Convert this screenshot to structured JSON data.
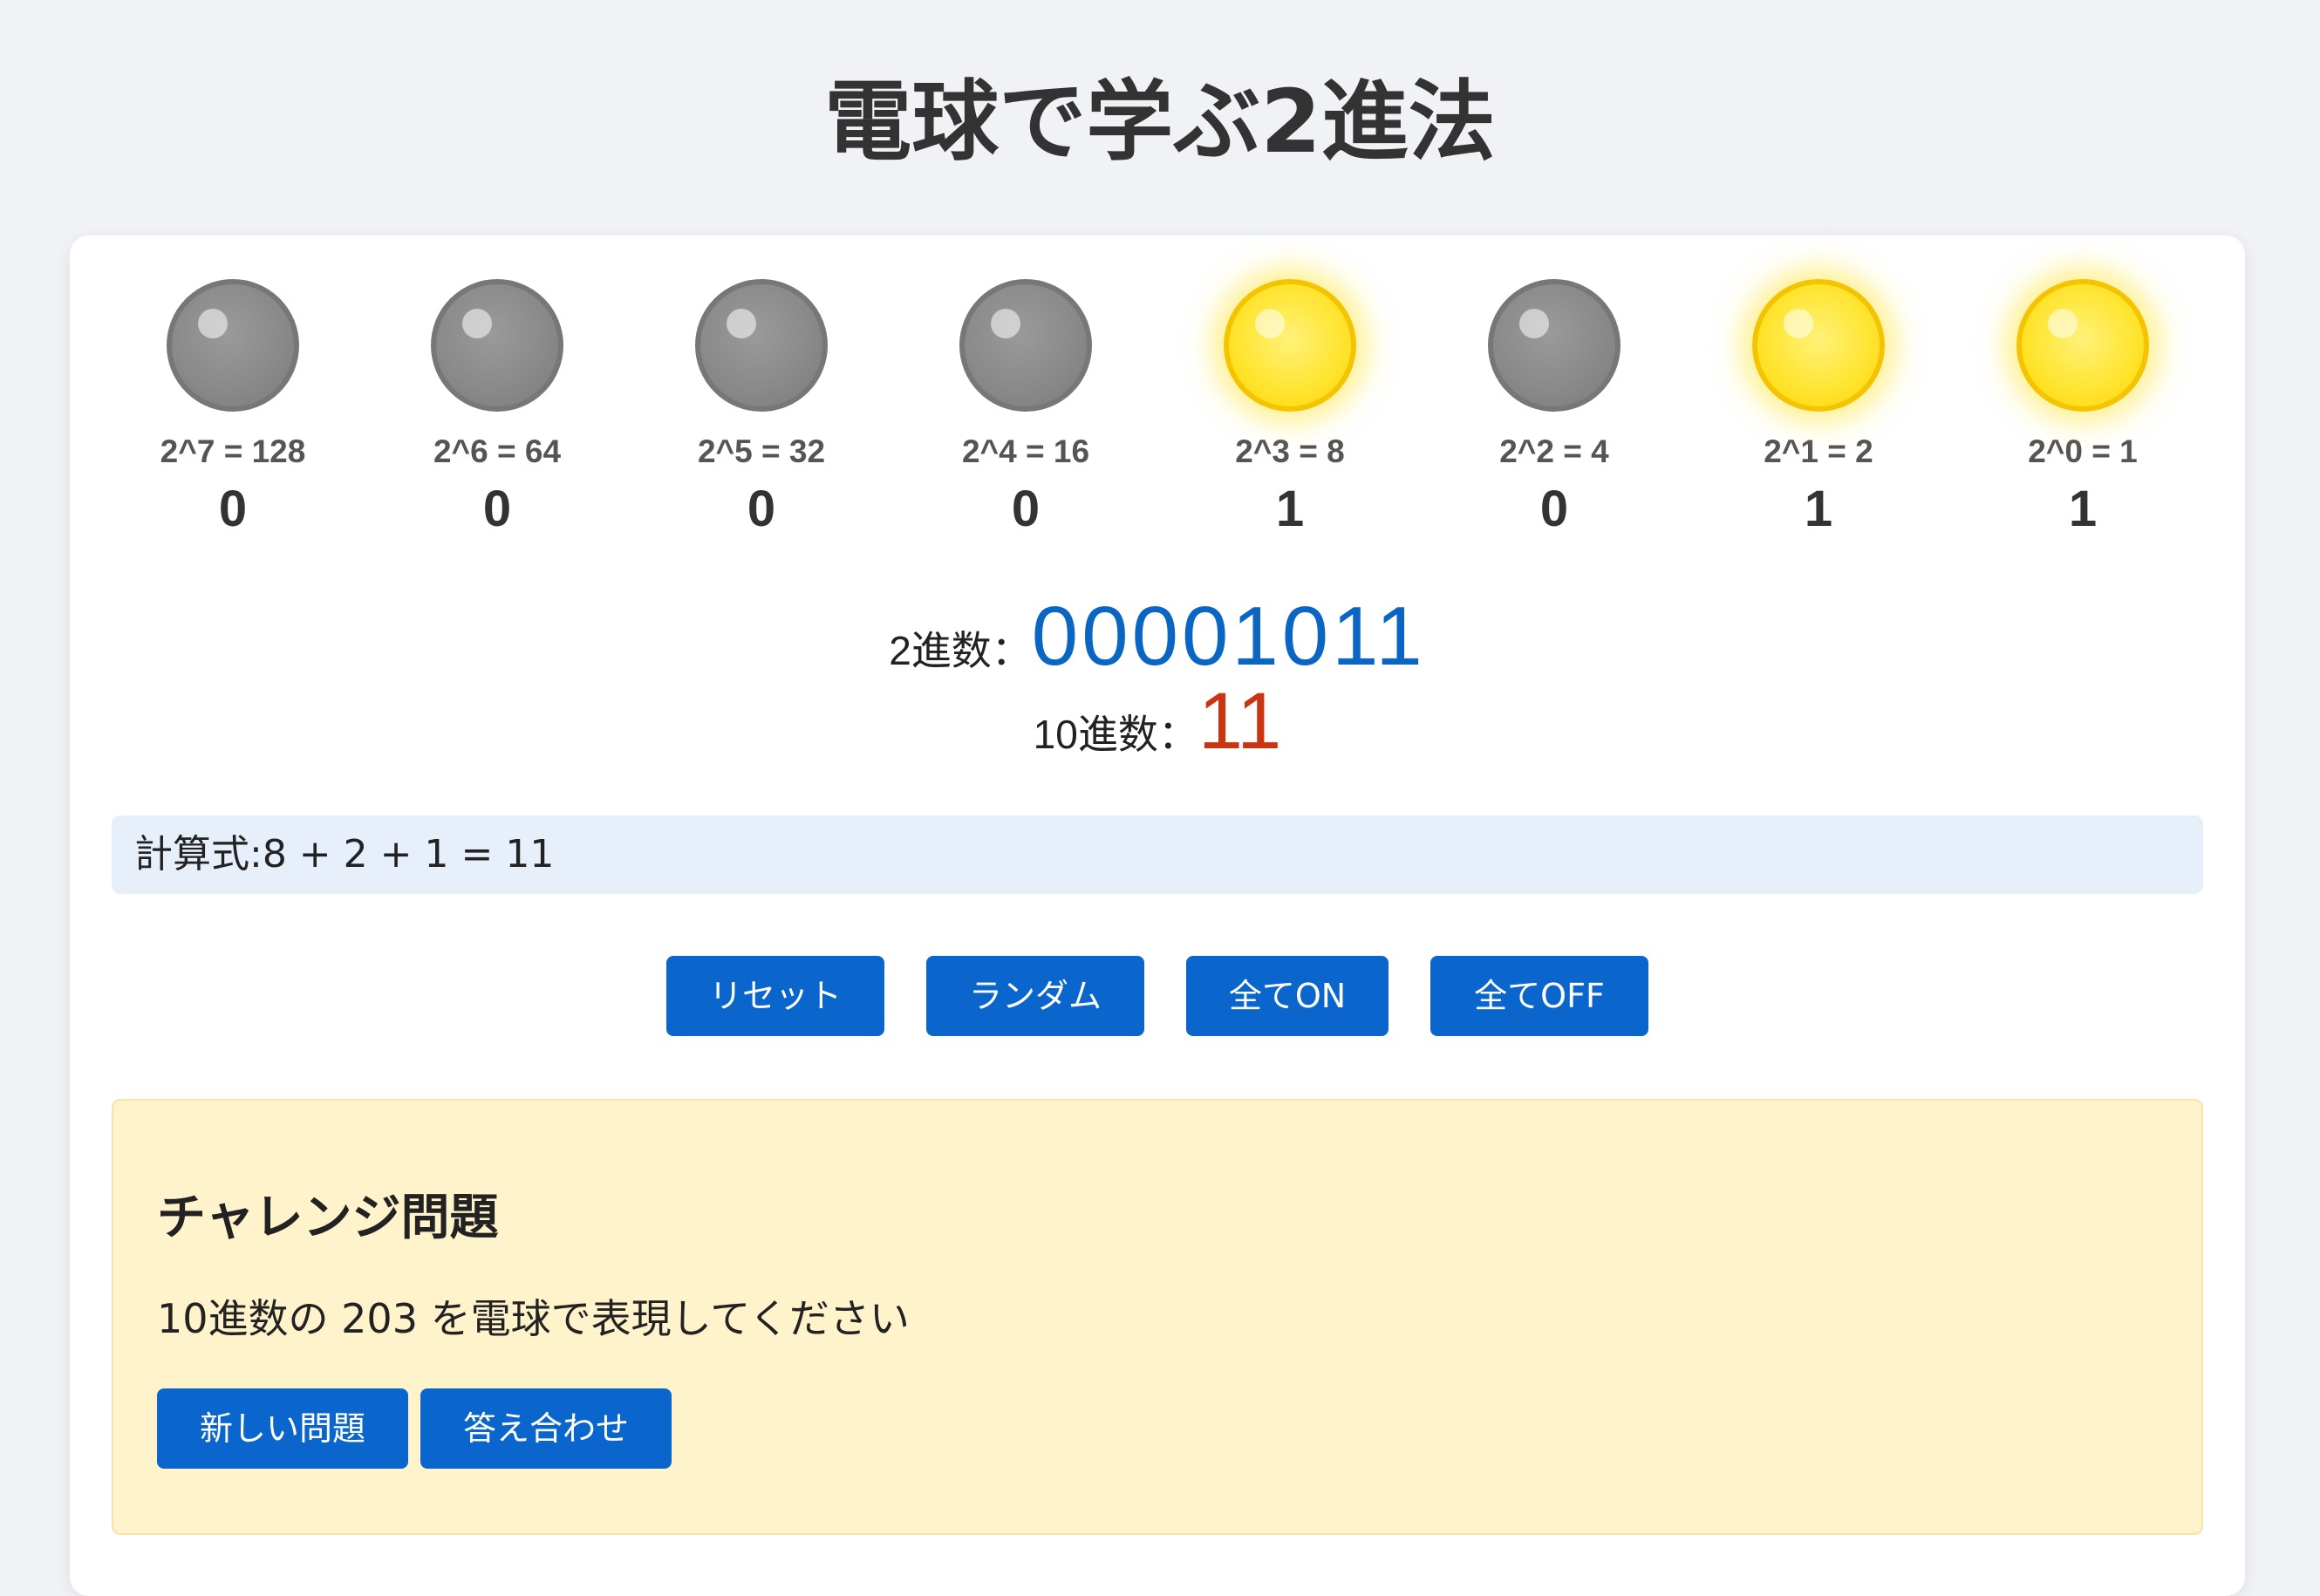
{
  "title": "電球で学ぶ2進法",
  "bulbs": [
    {
      "power": "2^7 = 128",
      "bit": "0",
      "on": false
    },
    {
      "power": "2^6 = 64",
      "bit": "0",
      "on": false
    },
    {
      "power": "2^5 = 32",
      "bit": "0",
      "on": false
    },
    {
      "power": "2^4 = 16",
      "bit": "0",
      "on": false
    },
    {
      "power": "2^3 = 8",
      "bit": "1",
      "on": true
    },
    {
      "power": "2^2 = 4",
      "bit": "0",
      "on": false
    },
    {
      "power": "2^1 = 2",
      "bit": "1",
      "on": true
    },
    {
      "power": "2^0 = 1",
      "bit": "1",
      "on": true
    }
  ],
  "result": {
    "binary_label": "2進数：",
    "binary_value": "00001011",
    "decimal_label": "10進数：",
    "decimal_value": "11"
  },
  "formula": "計算式:8 + 2 + 1 = 11",
  "controls": {
    "reset": "リセット",
    "random": "ランダム",
    "all_on": "全てON",
    "all_off": "全てOFF"
  },
  "challenge": {
    "title": "チャレンジ問題",
    "question": "10進数の 203 を電球で表現してください",
    "new_problem": "新しい問題",
    "check_answer": "答え合わせ"
  },
  "colors": {
    "accent": "#0a66cc",
    "binary_value": "#0a66c2",
    "decimal_value": "#cc3311",
    "bulb_on": "#ffe533",
    "bulb_off": "#8a8a8a",
    "formula_bg": "#e7effb",
    "challenge_bg": "#fff3cc"
  },
  "icons": {
    "bulb_on": "lightbulb-on-icon",
    "bulb_off": "lightbulb-off-icon"
  }
}
